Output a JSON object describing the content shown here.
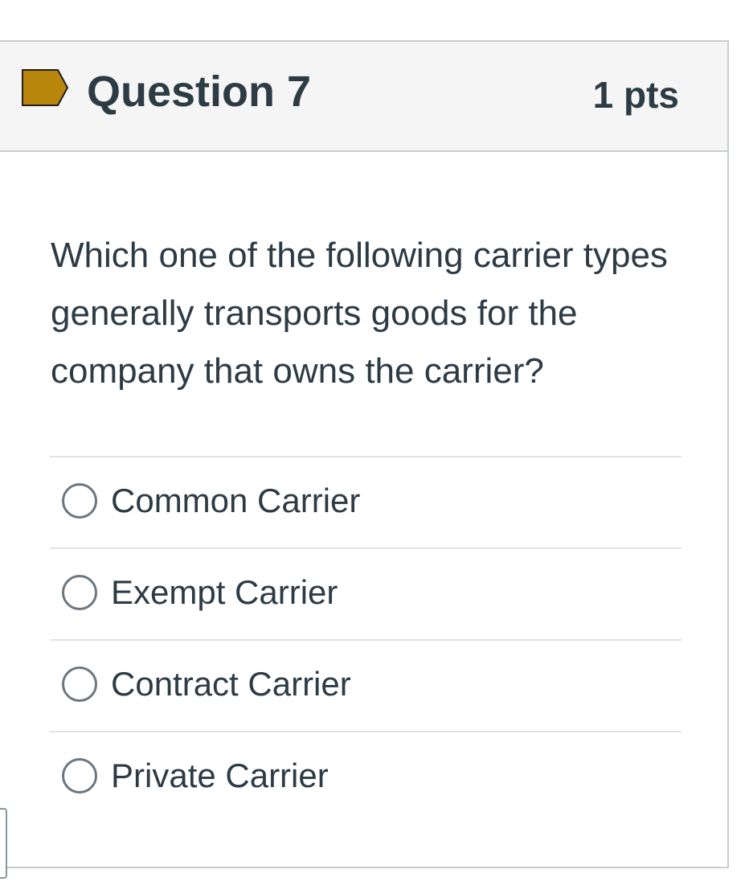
{
  "question": {
    "flag_icon": "bookmark-flag-icon",
    "flag_color": "#b8860b",
    "title": "Question 7",
    "points": "1 pts",
    "text": "Which one of the following carrier types generally transports goods for the company that owns the carrier?",
    "answers": [
      {
        "label": "Common Carrier",
        "selected": false
      },
      {
        "label": "Exempt Carrier",
        "selected": false
      },
      {
        "label": "Contract Carrier",
        "selected": false
      },
      {
        "label": "Private Carrier",
        "selected": false
      }
    ]
  }
}
